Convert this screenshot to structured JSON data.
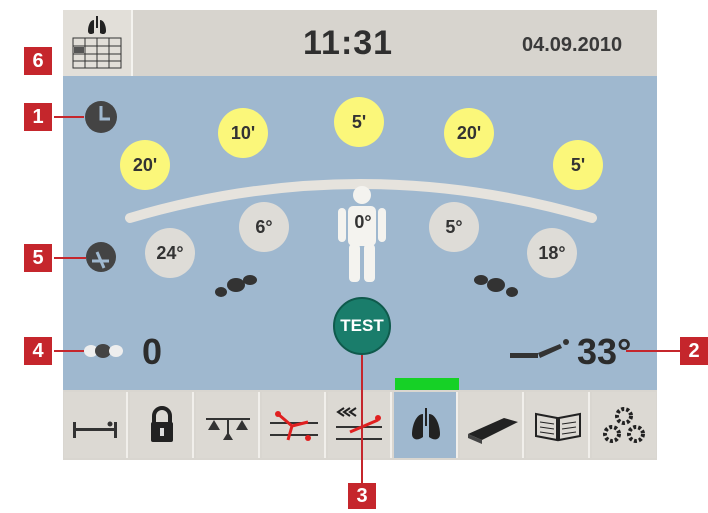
{
  "header": {
    "time": "11:31",
    "date": "04.09.2010",
    "icon": "lung-grid-icon"
  },
  "rotation_times": [
    "20'",
    "10'",
    "5'",
    "20'",
    "5'"
  ],
  "angles": [
    "24°",
    "6°",
    "0°",
    "5°",
    "18°"
  ],
  "left_count": "0",
  "bed_angle": "33°",
  "test_label": "TEST",
  "callouts": [
    "6",
    "1",
    "5",
    "4",
    "2",
    "3"
  ],
  "toolbar": {
    "items": [
      "bed-flat-icon",
      "lock-icon",
      "scale-icon",
      "ppt-figure-icon",
      "trendelenburg-icon",
      "lung-icon",
      "mattress-icon",
      "manual-book-icon",
      "settings-gears-icon"
    ],
    "active_index": 5
  },
  "colors": {
    "panel": "#9fb8cf",
    "yellow": "#fbf77a",
    "active_indicator": "#16d126",
    "test": "#1a7d6b",
    "callout": "#c5262c"
  }
}
